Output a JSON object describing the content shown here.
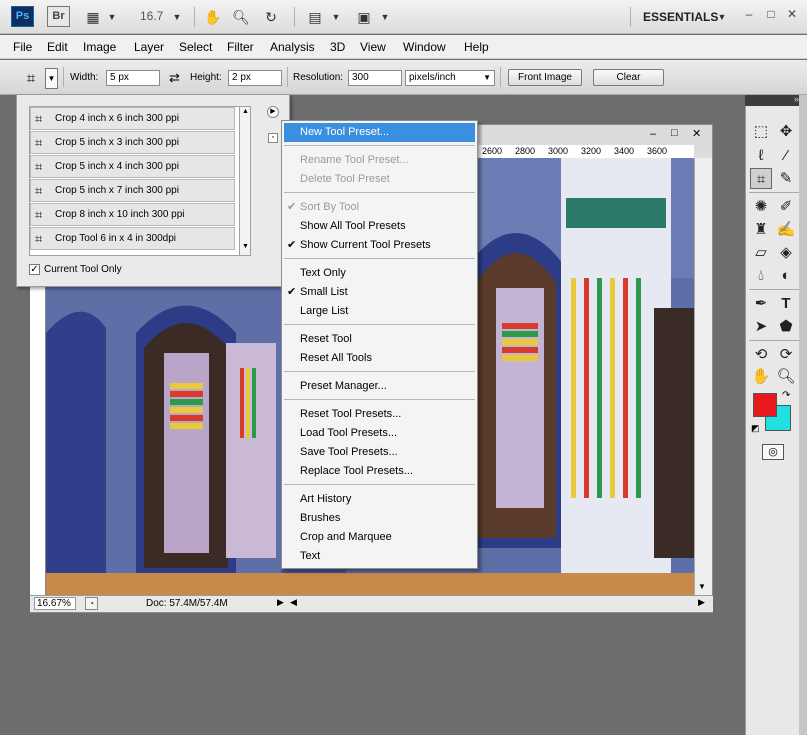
{
  "appbar": {
    "ps_label": "Ps",
    "br_label": "Br",
    "zoom": "16.7",
    "workspace": "ESSENTIALS",
    "icons": [
      "frame-icon",
      "hand-icon",
      "zoom-icon",
      "rotate-view-icon",
      "arrange-docs-icon",
      "screen-mode-icon"
    ]
  },
  "menubar": {
    "items": [
      "File",
      "Edit",
      "Image",
      "Layer",
      "Select",
      "Filter",
      "Analysis",
      "3D",
      "View",
      "Window",
      "Help"
    ]
  },
  "options": {
    "width_label": "Width:",
    "width_value": "5 px",
    "height_label": "Height:",
    "height_value": "2 px",
    "resolution_label": "Resolution:",
    "resolution_value": "300",
    "resolution_unit": "pixels/inch",
    "front_image_label": "Front Image",
    "clear_label": "Clear"
  },
  "presets": {
    "items": [
      "Crop 4 inch x 6 inch 300 ppi",
      "Crop 5 inch x 3 inch 300 ppi",
      "Crop 5 inch x 4 inch 300 ppi",
      "Crop 5 inch x 7 inch 300 ppi",
      "Crop 8 inch x 10 inch 300 ppi",
      "Crop Tool 6 in x 4 in 300dpi"
    ],
    "current_tool_only": "Current Tool Only"
  },
  "document": {
    "ruler_ticks": [
      "2600",
      "2800",
      "3000",
      "3200",
      "3400",
      "3600"
    ],
    "zoom": "16.67%",
    "doc_size": "Doc: 57.4M/57.4M"
  },
  "context_menu": {
    "items": [
      {
        "label": "New Tool Preset...",
        "state": "highlighted"
      },
      {
        "label": "Rename Tool Preset...",
        "state": "disabled"
      },
      {
        "label": "Delete Tool Preset",
        "state": "disabled"
      },
      {
        "label": "Sort By Tool",
        "state": "disabled-checked"
      },
      {
        "label": "Show All Tool Presets",
        "state": "normal"
      },
      {
        "label": "Show Current Tool Presets",
        "state": "checked"
      },
      {
        "label": "Text Only",
        "state": "normal"
      },
      {
        "label": "Small List",
        "state": "checked"
      },
      {
        "label": "Large List",
        "state": "normal"
      },
      {
        "label": "Reset Tool",
        "state": "normal"
      },
      {
        "label": "Reset All Tools",
        "state": "normal"
      },
      {
        "label": "Preset Manager...",
        "state": "normal"
      },
      {
        "label": "Reset Tool Presets...",
        "state": "normal"
      },
      {
        "label": "Load Tool Presets...",
        "state": "normal"
      },
      {
        "label": "Save Tool Presets...",
        "state": "normal"
      },
      {
        "label": "Replace Tool Presets...",
        "state": "normal"
      },
      {
        "label": "Art History",
        "state": "normal"
      },
      {
        "label": "Brushes",
        "state": "normal"
      },
      {
        "label": "Crop and Marquee",
        "state": "normal"
      },
      {
        "label": "Text",
        "state": "normal"
      }
    ]
  },
  "colors": {
    "foreground": "#e8191d",
    "background": "#20e0e1",
    "highlight": "#3a8fe1"
  }
}
